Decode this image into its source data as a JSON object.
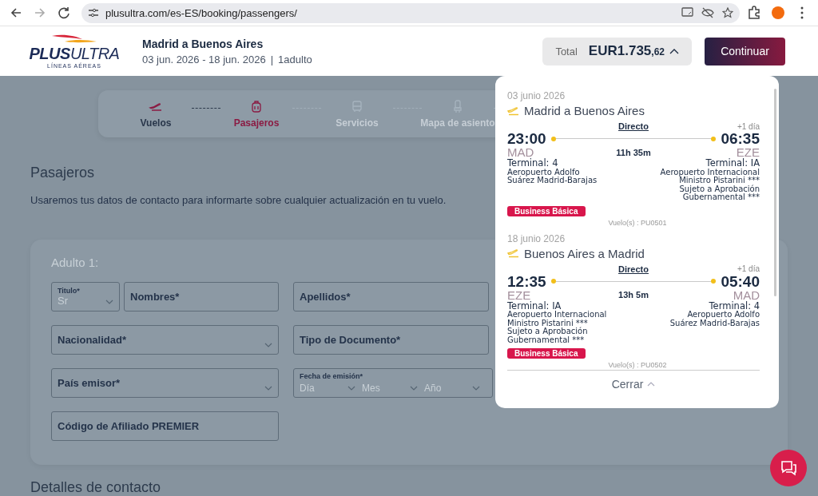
{
  "browser": {
    "url": "plusultra.com/es-ES/booking/passengers/"
  },
  "header": {
    "logo": {
      "wordmark": "**PLUS**ULTRA",
      "tagline": "LÍNEAS AÉREAS"
    },
    "route": "Madrid a Buenos Aires",
    "dates": "03 jun. 2026 - 18 jun. 2026",
    "separator": "|",
    "passengers": "1adulto",
    "total": {
      "label": "Total",
      "currency": "EUR",
      "amount": "1.735",
      "decimals": ",62",
      "expanded": true
    },
    "continue_button": "Continuar"
  },
  "stepper": [
    {
      "label": "Vuelos",
      "completed": true,
      "selected": false
    },
    {
      "label": "Pasajeros",
      "completed": false,
      "selected": true
    },
    {
      "label": "Servicios",
      "completed": false,
      "selected": false
    },
    {
      "label": "Mapa de asiento",
      "completed": false,
      "selected": false
    }
  ],
  "page": {
    "title": "Pasajeros",
    "intro": "Usaremos tus datos de contacto para informarte sobre cualquier actualización en tu vuelo."
  },
  "form": {
    "title": "Adulto 1:",
    "rows": [
      {
        "left": [
          {
            "kind": "select",
            "label": "Titulo*",
            "value": "Sr"
          },
          {
            "kind": "text",
            "placeholder": "Nombres*"
          }
        ],
        "right": [
          {
            "kind": "text",
            "placeholder": "Apellidos*"
          }
        ]
      },
      {
        "left": [
          {
            "kind": "dropdown",
            "placeholder": "Nacionalidad*"
          }
        ],
        "right": [
          {
            "kind": "text",
            "placeholder": "Tipo de Documento*"
          }
        ]
      },
      {
        "left": [
          {
            "kind": "dropdown",
            "placeholder": "País emisor*"
          }
        ],
        "right": [
          {
            "kind": "date",
            "label": "Fecha de emisión*",
            "parts": [
              "Día",
              "Mes",
              "Año"
            ]
          }
        ]
      },
      {
        "left": [
          {
            "kind": "text",
            "placeholder": "Código de Afiliado PREMIER"
          }
        ],
        "right": []
      }
    ]
  },
  "contact_section": {
    "title": "Detalles de contacto"
  },
  "summary": {
    "segments": [
      {
        "date": "03 junio 2026",
        "route": "Madrid a Buenos Aires",
        "stops": "Directo",
        "duration": "11h 35m",
        "day_offset": "+1 día",
        "fare": "Business Básica",
        "flight": "Vuelo(s) : PU0501",
        "depart": {
          "time": "23:00",
          "code": "MAD",
          "terminal": "Terminal: 4",
          "airport": [
            "Aeropuerto Adolfo",
            "Suárez Madrid-Barajas"
          ]
        },
        "arrive": {
          "time": "06:35",
          "code": "EZE",
          "terminal": "Terminal: IA",
          "airport": [
            "Aeropuerto Internacional",
            "Ministro Pistarini ***",
            "Sujeto a Aprobación",
            "Gubernamental ***"
          ]
        }
      },
      {
        "date": "18 junio 2026",
        "route": "Buenos Aires a Madrid",
        "stops": "Directo",
        "duration": "13h 5m",
        "day_offset": "+1 día",
        "fare": "Business Básica",
        "flight": "Vuelo(s) : PU0502",
        "depart": {
          "time": "12:35",
          "code": "EZE",
          "terminal": "Terminal: IA",
          "airport": [
            "Aeropuerto Internacional",
            "Ministro Pistarini ***",
            "Sujeto a Aprobación",
            "Gubernamental ***"
          ]
        },
        "arrive": {
          "time": "05:40",
          "code": "MAD",
          "terminal": "Terminal: 4",
          "airport": [
            "Aeropuerto Adolfo",
            "Suárez Madrid-Barajas"
          ]
        }
      }
    ],
    "close_button": "Cerrar"
  }
}
